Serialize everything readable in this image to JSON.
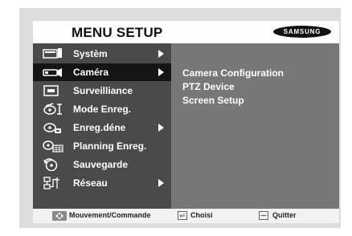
{
  "header": {
    "title": "MENU SETUP",
    "logo": "SAMSUNG"
  },
  "sidebar": {
    "items": [
      {
        "label": "Systèm",
        "icon": "system-icon",
        "has_submenu": true,
        "selected": false
      },
      {
        "label": "Caméra",
        "icon": "camera-icon",
        "has_submenu": true,
        "selected": true
      },
      {
        "label": "Surveilliance",
        "icon": "monitor-icon",
        "has_submenu": false,
        "selected": false
      },
      {
        "label": "Mode Enreg.",
        "icon": "record-mode-icon",
        "has_submenu": false,
        "selected": false
      },
      {
        "label": "Enreg.déne",
        "icon": "event-record-icon",
        "has_submenu": true,
        "selected": false
      },
      {
        "label": "Planning Enreg.",
        "icon": "schedule-icon",
        "has_submenu": false,
        "selected": false
      },
      {
        "label": "Sauvegarde",
        "icon": "backup-icon",
        "has_submenu": false,
        "selected": false
      },
      {
        "label": "Réseau",
        "icon": "network-icon",
        "has_submenu": true,
        "selected": false
      }
    ]
  },
  "submenu": {
    "items": [
      "Camera Configuration",
      "PTZ Device",
      "Screen Setup"
    ]
  },
  "footer": {
    "move": "Mouvement/Commande",
    "select": "Choisi",
    "exit": "Quitter"
  },
  "colors": {
    "sidebar_bg": "#4a4a4a",
    "selected_bg": "#151515",
    "content_bg": "#787878",
    "frame_bg": "#dcdcdc"
  }
}
